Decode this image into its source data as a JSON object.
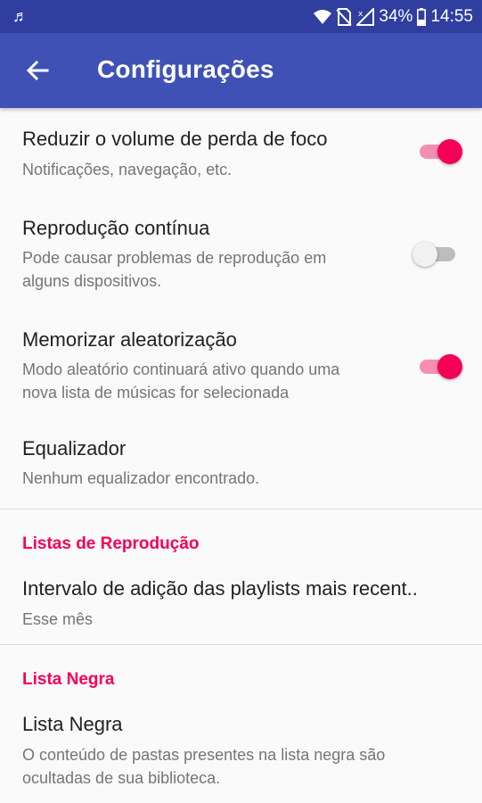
{
  "status_bar": {
    "music_icon": "music-note-icon",
    "battery": "34%",
    "time": "14:55",
    "icons": [
      "wifi-icon",
      "no-sim-icon",
      "signal-icon",
      "battery-icon"
    ]
  },
  "toolbar": {
    "back_icon": "arrow-back-icon",
    "title": "Configurações"
  },
  "settings": [
    {
      "title": "Reduzir o volume de perda de foco",
      "summary": "Notificações, navegação, etc.",
      "toggle": true
    },
    {
      "title": "Reprodução contínua",
      "summary_lines": [
        "Pode causar problemas de reprodução em",
        "alguns dispositivos."
      ],
      "toggle": false
    },
    {
      "title": "Memorizar aleatorização",
      "summary_lines": [
        "Modo aleatório continuará ativo quando uma",
        "nova lista de músicas for selecionada"
      ],
      "toggle": true
    },
    {
      "title": "Equalizador",
      "summary": "Nenhum equalizador encontrado."
    }
  ],
  "playlists_section": {
    "header": "Listas de Reprodução",
    "item": {
      "title": "Intervalo de adição das playlists mais recent..",
      "summary": "Esse mês"
    }
  },
  "blacklist_section": {
    "header": "Lista Negra",
    "item": {
      "title": "Lista Negra",
      "summary_lines": [
        "O conteúdo de pastas presentes na lista negra são",
        "ocultadas de sua biblioteca."
      ]
    }
  },
  "colors": {
    "status_bar": "#303f9f",
    "toolbar": "#3f51b5",
    "accent": "#f50057",
    "accent_track": "#f48fb1"
  }
}
